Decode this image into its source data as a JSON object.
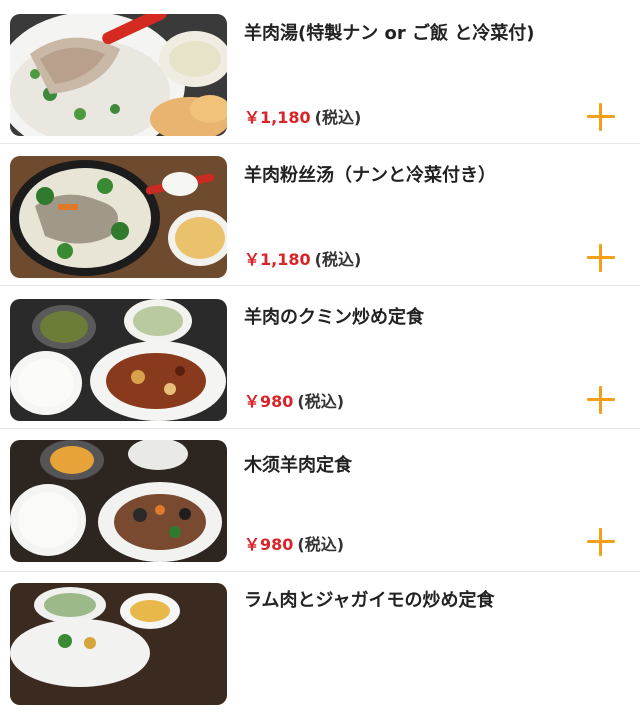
{
  "menu": {
    "items": [
      {
        "name": "羊肉湯(特製ナン or ご飯 と冷菜付)",
        "price": "￥1,180",
        "tax": "(税込)",
        "image_icon": "lamb-soup-photo"
      },
      {
        "name": "羊肉粉丝汤（ナンと冷菜付き）",
        "price": "￥1,180",
        "tax": "(税込)",
        "image_icon": "lamb-noodle-soup-photo"
      },
      {
        "name": "羊肉のクミン炒め定食",
        "price": "￥980",
        "tax": "(税込)",
        "image_icon": "cumin-lamb-set-photo"
      },
      {
        "name": "木须羊肉定食",
        "price": "￥980",
        "tax": "(税込)",
        "image_icon": "muxu-lamb-set-photo"
      },
      {
        "name": "ラム肉とジャガイモの炒め定食",
        "price": "",
        "tax": "",
        "image_icon": "lamb-potato-set-photo"
      }
    ]
  },
  "colors": {
    "price": "#d8252a",
    "add_button": "#f2a01a",
    "divider": "#e6e6e6"
  }
}
